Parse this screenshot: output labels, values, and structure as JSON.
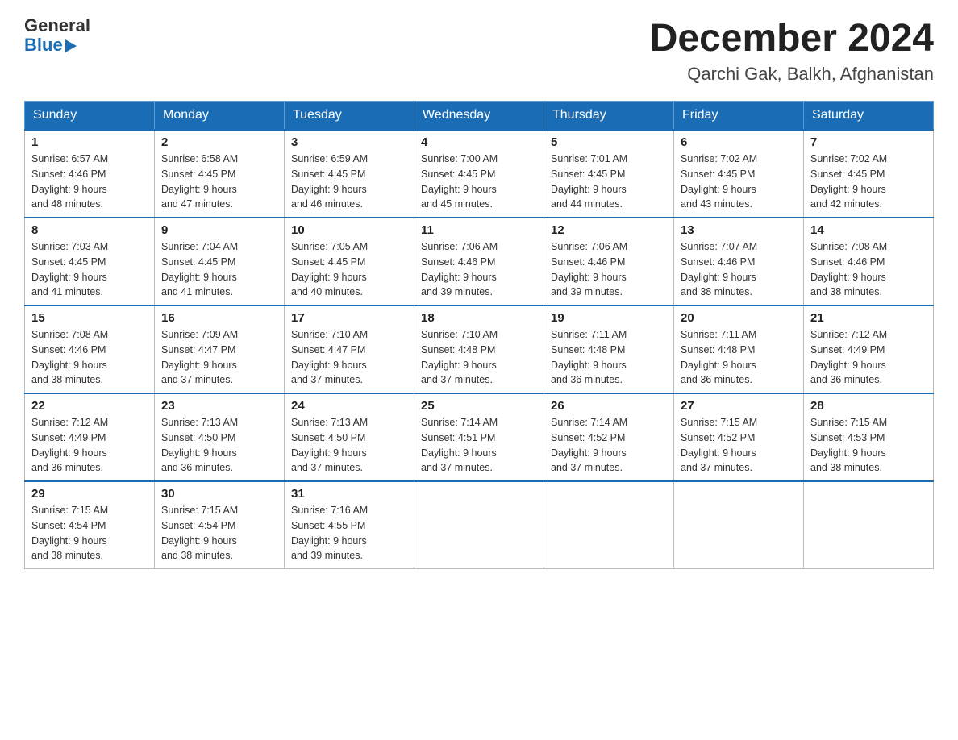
{
  "header": {
    "logo_general": "General",
    "logo_blue": "Blue",
    "month_title": "December 2024",
    "location": "Qarchi Gak, Balkh, Afghanistan"
  },
  "days_of_week": [
    "Sunday",
    "Monday",
    "Tuesday",
    "Wednesday",
    "Thursday",
    "Friday",
    "Saturday"
  ],
  "weeks": [
    [
      {
        "day": "1",
        "sunrise": "6:57 AM",
        "sunset": "4:46 PM",
        "daylight": "9 hours and 48 minutes."
      },
      {
        "day": "2",
        "sunrise": "6:58 AM",
        "sunset": "4:45 PM",
        "daylight": "9 hours and 47 minutes."
      },
      {
        "day": "3",
        "sunrise": "6:59 AM",
        "sunset": "4:45 PM",
        "daylight": "9 hours and 46 minutes."
      },
      {
        "day": "4",
        "sunrise": "7:00 AM",
        "sunset": "4:45 PM",
        "daylight": "9 hours and 45 minutes."
      },
      {
        "day": "5",
        "sunrise": "7:01 AM",
        "sunset": "4:45 PM",
        "daylight": "9 hours and 44 minutes."
      },
      {
        "day": "6",
        "sunrise": "7:02 AM",
        "sunset": "4:45 PM",
        "daylight": "9 hours and 43 minutes."
      },
      {
        "day": "7",
        "sunrise": "7:02 AM",
        "sunset": "4:45 PM",
        "daylight": "9 hours and 42 minutes."
      }
    ],
    [
      {
        "day": "8",
        "sunrise": "7:03 AM",
        "sunset": "4:45 PM",
        "daylight": "9 hours and 41 minutes."
      },
      {
        "day": "9",
        "sunrise": "7:04 AM",
        "sunset": "4:45 PM",
        "daylight": "9 hours and 41 minutes."
      },
      {
        "day": "10",
        "sunrise": "7:05 AM",
        "sunset": "4:45 PM",
        "daylight": "9 hours and 40 minutes."
      },
      {
        "day": "11",
        "sunrise": "7:06 AM",
        "sunset": "4:46 PM",
        "daylight": "9 hours and 39 minutes."
      },
      {
        "day": "12",
        "sunrise": "7:06 AM",
        "sunset": "4:46 PM",
        "daylight": "9 hours and 39 minutes."
      },
      {
        "day": "13",
        "sunrise": "7:07 AM",
        "sunset": "4:46 PM",
        "daylight": "9 hours and 38 minutes."
      },
      {
        "day": "14",
        "sunrise": "7:08 AM",
        "sunset": "4:46 PM",
        "daylight": "9 hours and 38 minutes."
      }
    ],
    [
      {
        "day": "15",
        "sunrise": "7:08 AM",
        "sunset": "4:46 PM",
        "daylight": "9 hours and 38 minutes."
      },
      {
        "day": "16",
        "sunrise": "7:09 AM",
        "sunset": "4:47 PM",
        "daylight": "9 hours and 37 minutes."
      },
      {
        "day": "17",
        "sunrise": "7:10 AM",
        "sunset": "4:47 PM",
        "daylight": "9 hours and 37 minutes."
      },
      {
        "day": "18",
        "sunrise": "7:10 AM",
        "sunset": "4:48 PM",
        "daylight": "9 hours and 37 minutes."
      },
      {
        "day": "19",
        "sunrise": "7:11 AM",
        "sunset": "4:48 PM",
        "daylight": "9 hours and 36 minutes."
      },
      {
        "day": "20",
        "sunrise": "7:11 AM",
        "sunset": "4:48 PM",
        "daylight": "9 hours and 36 minutes."
      },
      {
        "day": "21",
        "sunrise": "7:12 AM",
        "sunset": "4:49 PM",
        "daylight": "9 hours and 36 minutes."
      }
    ],
    [
      {
        "day": "22",
        "sunrise": "7:12 AM",
        "sunset": "4:49 PM",
        "daylight": "9 hours and 36 minutes."
      },
      {
        "day": "23",
        "sunrise": "7:13 AM",
        "sunset": "4:50 PM",
        "daylight": "9 hours and 36 minutes."
      },
      {
        "day": "24",
        "sunrise": "7:13 AM",
        "sunset": "4:50 PM",
        "daylight": "9 hours and 37 minutes."
      },
      {
        "day": "25",
        "sunrise": "7:14 AM",
        "sunset": "4:51 PM",
        "daylight": "9 hours and 37 minutes."
      },
      {
        "day": "26",
        "sunrise": "7:14 AM",
        "sunset": "4:52 PM",
        "daylight": "9 hours and 37 minutes."
      },
      {
        "day": "27",
        "sunrise": "7:15 AM",
        "sunset": "4:52 PM",
        "daylight": "9 hours and 37 minutes."
      },
      {
        "day": "28",
        "sunrise": "7:15 AM",
        "sunset": "4:53 PM",
        "daylight": "9 hours and 38 minutes."
      }
    ],
    [
      {
        "day": "29",
        "sunrise": "7:15 AM",
        "sunset": "4:54 PM",
        "daylight": "9 hours and 38 minutes."
      },
      {
        "day": "30",
        "sunrise": "7:15 AM",
        "sunset": "4:54 PM",
        "daylight": "9 hours and 38 minutes."
      },
      {
        "day": "31",
        "sunrise": "7:16 AM",
        "sunset": "4:55 PM",
        "daylight": "9 hours and 39 minutes."
      },
      null,
      null,
      null,
      null
    ]
  ],
  "sunrise_label": "Sunrise:",
  "sunset_label": "Sunset:",
  "daylight_label": "Daylight:"
}
